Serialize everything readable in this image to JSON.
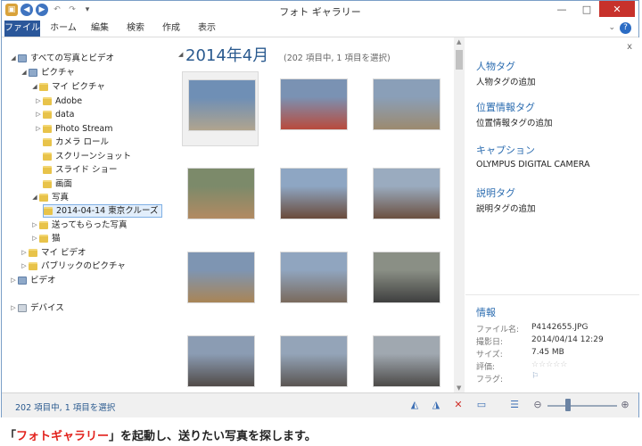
{
  "window": {
    "title": "フォト ギャラリー"
  },
  "ribbon": {
    "tabs": [
      {
        "label": "ファイル",
        "active": true
      },
      {
        "label": "ホーム"
      },
      {
        "label": "編集"
      },
      {
        "label": "検索"
      },
      {
        "label": "作成"
      },
      {
        "label": "表示"
      }
    ],
    "help_label": "?"
  },
  "nav": {
    "items": [
      {
        "label": "すべての写真とビデオ",
        "depth": 0,
        "icon": "lib",
        "arrow": "◢"
      },
      {
        "label": "ピクチャ",
        "depth": 1,
        "icon": "lib",
        "arrow": "◢"
      },
      {
        "label": "マイ ピクチャ",
        "depth": 2,
        "icon": "folder",
        "arrow": "◢"
      },
      {
        "label": "Adobe",
        "depth": 3,
        "icon": "folder",
        "arrow": "▷"
      },
      {
        "label": "data",
        "depth": 3,
        "icon": "folder",
        "arrow": "▷"
      },
      {
        "label": "Photo Stream",
        "depth": 3,
        "icon": "folder",
        "arrow": "▷"
      },
      {
        "label": "カメラ ロール",
        "depth": 3,
        "icon": "folder",
        "arrow": ""
      },
      {
        "label": "スクリーンショット",
        "depth": 3,
        "icon": "folder",
        "arrow": ""
      },
      {
        "label": "スライド ショー",
        "depth": 3,
        "icon": "folder",
        "arrow": ""
      },
      {
        "label": "画面",
        "depth": 3,
        "icon": "folder",
        "arrow": ""
      },
      {
        "label": "写真",
        "depth": 2,
        "icon": "folder",
        "arrow": "◢"
      },
      {
        "label": "2014-04-14 東京クルーズ",
        "depth": 3,
        "icon": "folder",
        "arrow": "",
        "selected": true
      },
      {
        "label": "送ってもらった写真",
        "depth": 2,
        "icon": "folder",
        "arrow": "▷"
      },
      {
        "label": "猫",
        "depth": 2,
        "icon": "folder",
        "arrow": "▷"
      },
      {
        "label": "マイ ビデオ",
        "depth": 1,
        "icon": "folder",
        "arrow": "▷"
      },
      {
        "label": "パブリックのピクチャ",
        "depth": 1,
        "icon": "folder",
        "arrow": "▷"
      },
      {
        "label": "ビデオ",
        "depth": 0,
        "icon": "lib",
        "arrow": "▷"
      },
      {
        "label": "デバイス",
        "depth": 0,
        "icon": "dev",
        "arrow": "▷"
      }
    ]
  },
  "gallery": {
    "month": "2014年4月",
    "count": "(202 項目中, 1 項目を選択)",
    "photos": [
      {
        "c1": "#6f8fb5",
        "c2": "#b0a48e"
      },
      {
        "c1": "#7a92b3",
        "c2": "#b94a3c"
      },
      {
        "c1": "#8a9fb8",
        "c2": "#9c8a6f"
      },
      {
        "c1": "#7c8a6a",
        "c2": "#b28a62"
      },
      {
        "c1": "#8ea6c3",
        "c2": "#6a4a3a"
      },
      {
        "c1": "#9aabbf",
        "c2": "#6b5040"
      },
      {
        "c1": "#7e95b2",
        "c2": "#a98556"
      },
      {
        "c1": "#90a5bf",
        "c2": "#7a6a5c"
      },
      {
        "c1": "#8a8f85",
        "c2": "#3f3f3f"
      },
      {
        "c1": "#8b9cb3",
        "c2": "#514b48"
      },
      {
        "c1": "#94a4b8",
        "c2": "#5a5552"
      },
      {
        "c1": "#a0a8b0",
        "c2": "#4c4a48"
      }
    ]
  },
  "details": {
    "close_label": "x",
    "people_tag_title": "人物タグ",
    "people_tag_add": "人物タグの追加",
    "location_tag_title": "位置情報タグ",
    "location_tag_add": "位置情報タグの追加",
    "caption_title": "キャプション",
    "caption_value": "OLYMPUS DIGITAL CAMERA",
    "desc_tag_title": "説明タグ",
    "desc_tag_add": "説明タグの追加",
    "info_title": "情報",
    "info": [
      {
        "label": "ファイル名:",
        "value": "P4142655.JPG"
      },
      {
        "label": "撮影日:",
        "value": "2014/04/14 12:29"
      },
      {
        "label": "サイズ:",
        "value": "7.45 MB"
      },
      {
        "label": "評価:",
        "value": ""
      },
      {
        "label": "フラグ:",
        "value": ""
      }
    ],
    "stars": "☆☆☆☆☆",
    "flag": "⚐"
  },
  "status": {
    "text": "202 項目中, 1 項目を選択"
  },
  "zoom_level": 0.3,
  "caption": {
    "open": "「",
    "app": "フォトギャラリー",
    "rest": "」を起動し、送りたい写真を探します。"
  }
}
